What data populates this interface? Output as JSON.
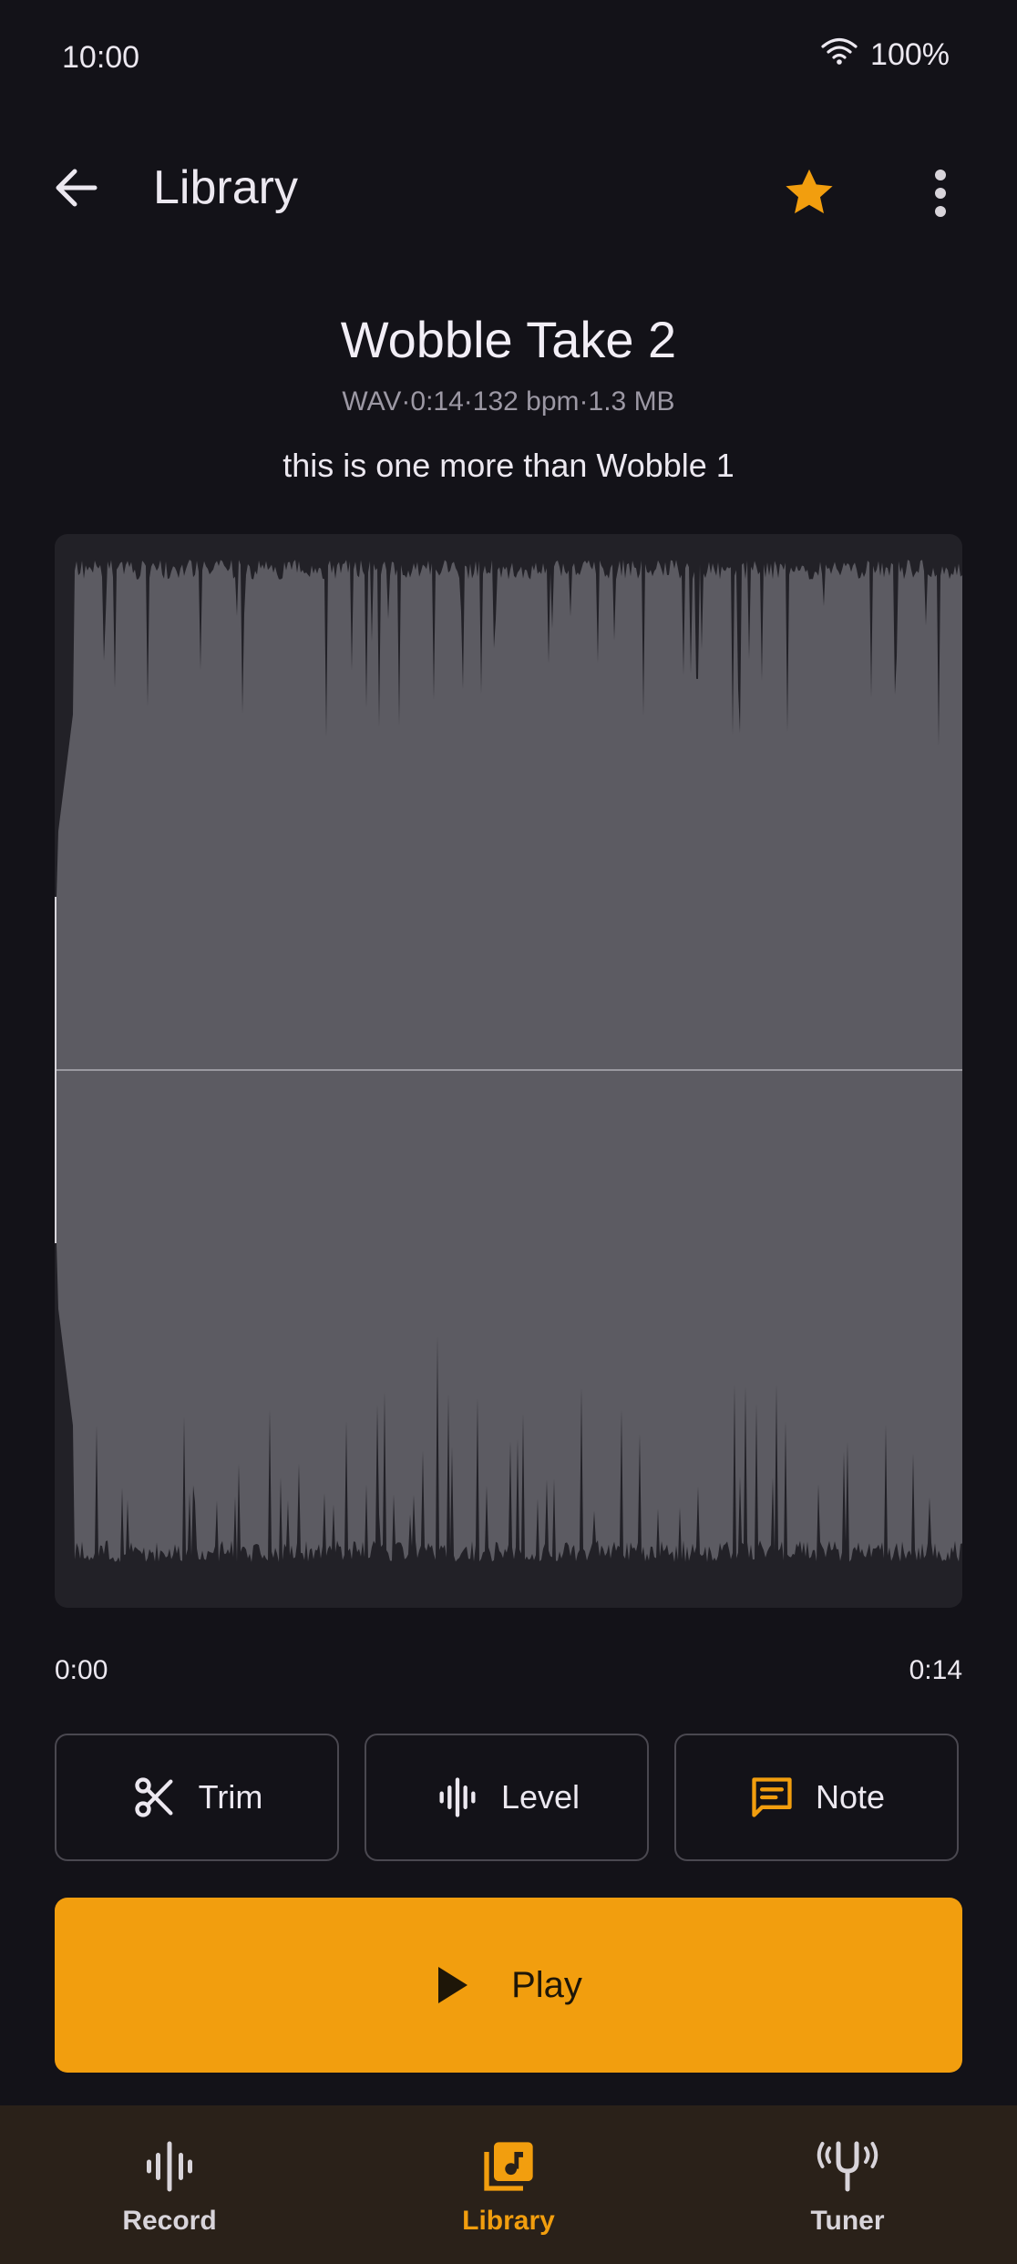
{
  "status": {
    "time": "10:00",
    "battery": "100%"
  },
  "appbar": {
    "title": "Library",
    "favorite": true
  },
  "recording": {
    "title": "Wobble Take 2",
    "meta": "WAV·0:14·132 bpm·1.3 MB",
    "note": "this is one more than Wobble 1",
    "time_start": "0:00",
    "time_end": "0:14"
  },
  "actions": [
    {
      "label": "Trim",
      "icon": "scissors-icon"
    },
    {
      "label": "Level",
      "icon": "waveform-level-icon"
    },
    {
      "label": "Note",
      "icon": "note-icon"
    }
  ],
  "play": {
    "label": "Play"
  },
  "nav": [
    {
      "label": "Record",
      "icon": "record-waveform-icon",
      "active": false
    },
    {
      "label": "Library",
      "icon": "library-music-icon",
      "active": true
    },
    {
      "label": "Tuner",
      "icon": "tuning-fork-icon",
      "active": false
    }
  ],
  "colors": {
    "accent": "#F29E0E",
    "background": "#131218",
    "waveform": "#5C5B62",
    "nav_background": "#2A2119"
  }
}
